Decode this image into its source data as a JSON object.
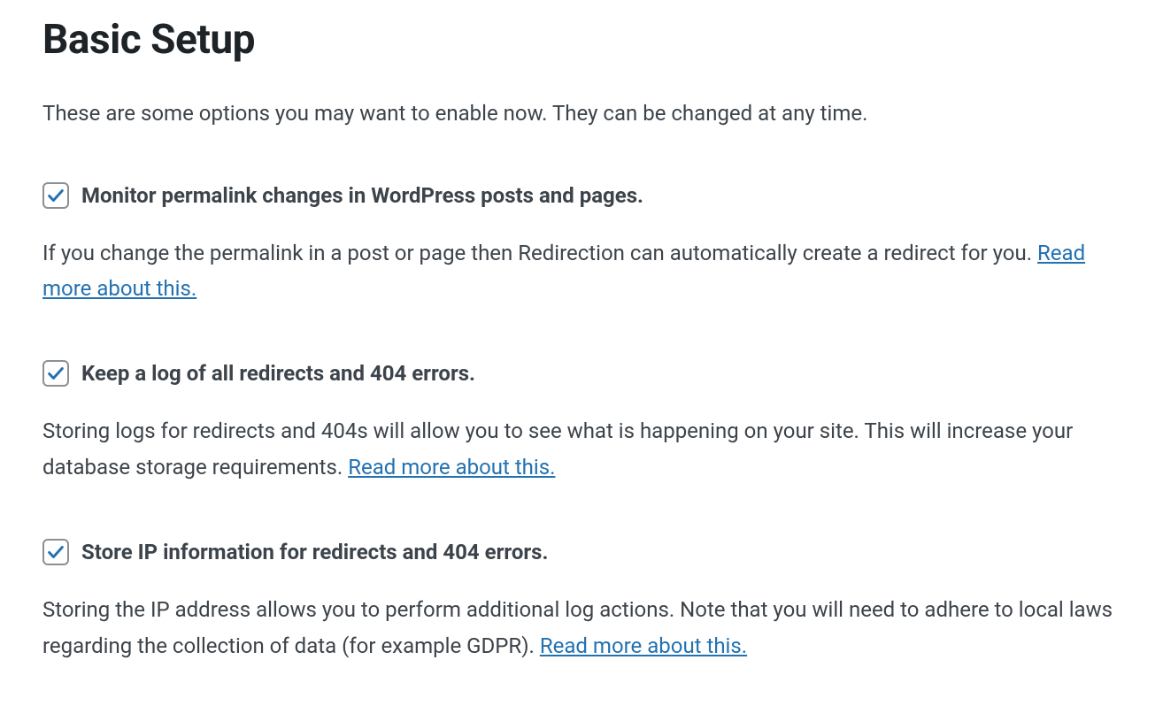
{
  "heading": "Basic Setup",
  "intro": "These are some options you may want to enable now. They can be changed at any time.",
  "read_more": "Read more about this.",
  "options": [
    {
      "label": "Monitor permalink changes in WordPress posts and pages.",
      "desc": "If you change the permalink in a post or page then Redirection can automatically create a redirect for you. ",
      "checked": true
    },
    {
      "label": "Keep a log of all redirects and 404 errors.",
      "desc": "Storing logs for redirects and 404s will allow you to see what is happening on your site. This will increase your database storage requirements. ",
      "checked": true
    },
    {
      "label": "Store IP information for redirects and 404 errors.",
      "desc": "Storing the IP address allows you to perform additional log actions. Note that you will need to adhere to local laws regarding the collection of data (for example GDPR). ",
      "checked": true
    }
  ]
}
